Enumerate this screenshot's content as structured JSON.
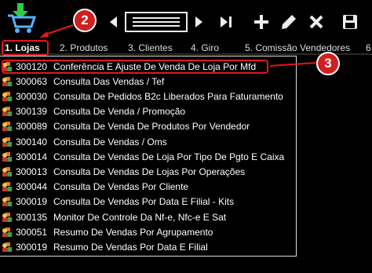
{
  "toolbar": {
    "logo_icon": "cart-download-icon",
    "buttons": [
      {
        "name": "first-button",
        "icon": "skip-first-icon"
      },
      {
        "name": "prev-button",
        "icon": "prev-icon"
      },
      {
        "name": "list-button",
        "icon": "list-icon"
      },
      {
        "name": "next-button",
        "icon": "next-icon"
      },
      {
        "name": "last-button",
        "icon": "skip-last-icon"
      },
      {
        "name": "add-button",
        "icon": "plus-icon"
      },
      {
        "name": "edit-button",
        "icon": "pencil-icon"
      },
      {
        "name": "delete-button",
        "icon": "x-icon"
      },
      {
        "name": "save-button",
        "icon": "floppy-icon"
      }
    ]
  },
  "tabs": [
    {
      "label": "1. Lojas",
      "active": true
    },
    {
      "label": "2. Produtos",
      "active": false
    },
    {
      "label": "3. Clientes",
      "active": false
    },
    {
      "label": "4. Giro",
      "active": false
    },
    {
      "label": "5. Comissão Vendedores",
      "active": false
    },
    {
      "label": "6",
      "active": false
    }
  ],
  "reports": [
    {
      "code": "300120",
      "desc": "Conferência E Ajuste De Venda De Loja Por Mfd"
    },
    {
      "code": "300063",
      "desc": "Consulta Das Vendas / Tef"
    },
    {
      "code": "300030",
      "desc": "Consulta De Pedidos B2c Liberados Para Faturamento"
    },
    {
      "code": "300139",
      "desc": "Consulta De Venda / Promoção"
    },
    {
      "code": "300089",
      "desc": "Consulta De Venda De Produtos Por Vendedor"
    },
    {
      "code": "300140",
      "desc": "Consulta De Vendas / Oms"
    },
    {
      "code": "300014",
      "desc": "Consulta De Vendas De Loja Por Tipo De Pgto E Caixa"
    },
    {
      "code": "300013",
      "desc": "Consulta De Vendas De Lojas Por Operações"
    },
    {
      "code": "300044",
      "desc": "Consulta De Vendas Por Cliente"
    },
    {
      "code": "300019",
      "desc": "Consulta De Vendas Por Data E Filial - Kits"
    },
    {
      "code": "300135",
      "desc": "Monitor De Controle Da Nf-e, Nfc-e E Sat"
    },
    {
      "code": "300051",
      "desc": "Resumo De Vendas Por Agrupamento"
    },
    {
      "code": "300019",
      "desc": "Resumo De Vendas Por Data E Filial"
    }
  ],
  "callouts": [
    "2",
    "3"
  ],
  "colors": {
    "background": "#000000",
    "callout": "#d11f1f",
    "highlight_box": "#e0181c"
  }
}
